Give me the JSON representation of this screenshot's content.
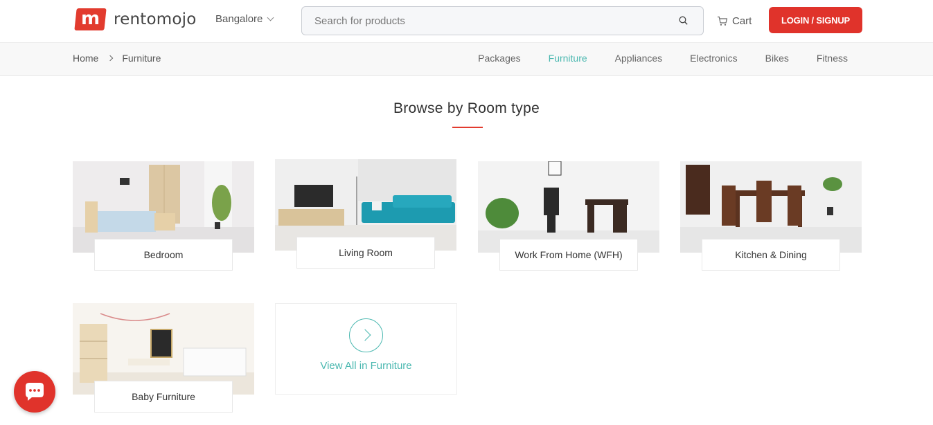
{
  "header": {
    "logo_letter": "m",
    "logo_text": "rentomojo",
    "city": "Bangalore",
    "search_placeholder": "Search for products",
    "cart_label": "Cart",
    "login_label": "LOGIN / SIGNUP"
  },
  "breadcrumb": {
    "home": "Home",
    "current": "Furniture"
  },
  "categories": [
    {
      "label": "Packages",
      "active": false
    },
    {
      "label": "Furniture",
      "active": true
    },
    {
      "label": "Appliances",
      "active": false
    },
    {
      "label": "Electronics",
      "active": false
    },
    {
      "label": "Bikes",
      "active": false
    },
    {
      "label": "Fitness",
      "active": false
    }
  ],
  "section_title": "Browse by Room type",
  "rooms": [
    {
      "label": "Bedroom"
    },
    {
      "label": "Living Room"
    },
    {
      "label": "Work From Home (WFH)"
    },
    {
      "label": "Kitchen & Dining"
    },
    {
      "label": "Baby Furniture"
    }
  ],
  "view_all_label": "View All in Furniture",
  "colors": {
    "brand_red": "#e0332b",
    "accent_teal": "#4bb8b0"
  }
}
